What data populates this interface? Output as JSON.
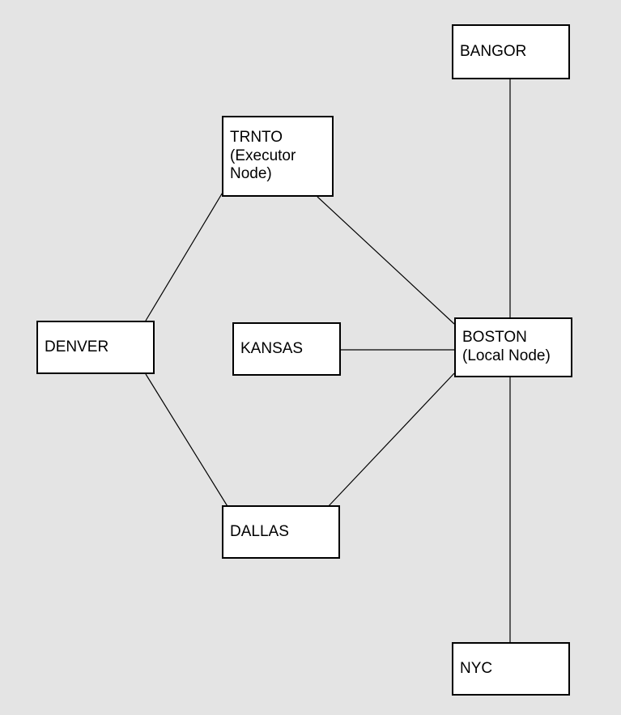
{
  "diagram": {
    "nodes": {
      "bangor": {
        "label": "BANGOR"
      },
      "trnto": {
        "label": "TRNTO (Executor Node)"
      },
      "denver": {
        "label": "DENVER"
      },
      "kansas": {
        "label": "KANSAS"
      },
      "boston": {
        "label": "BOSTON (Local Node)"
      },
      "dallas": {
        "label": "DALLAS"
      },
      "nyc": {
        "label": "NYC"
      }
    },
    "edges": [
      {
        "from": "bangor",
        "to": "boston"
      },
      {
        "from": "boston",
        "to": "nyc"
      },
      {
        "from": "trnto",
        "to": "denver"
      },
      {
        "from": "trnto",
        "to": "boston"
      },
      {
        "from": "denver",
        "to": "dallas"
      },
      {
        "from": "dallas",
        "to": "boston"
      },
      {
        "from": "kansas",
        "to": "boston"
      }
    ]
  }
}
